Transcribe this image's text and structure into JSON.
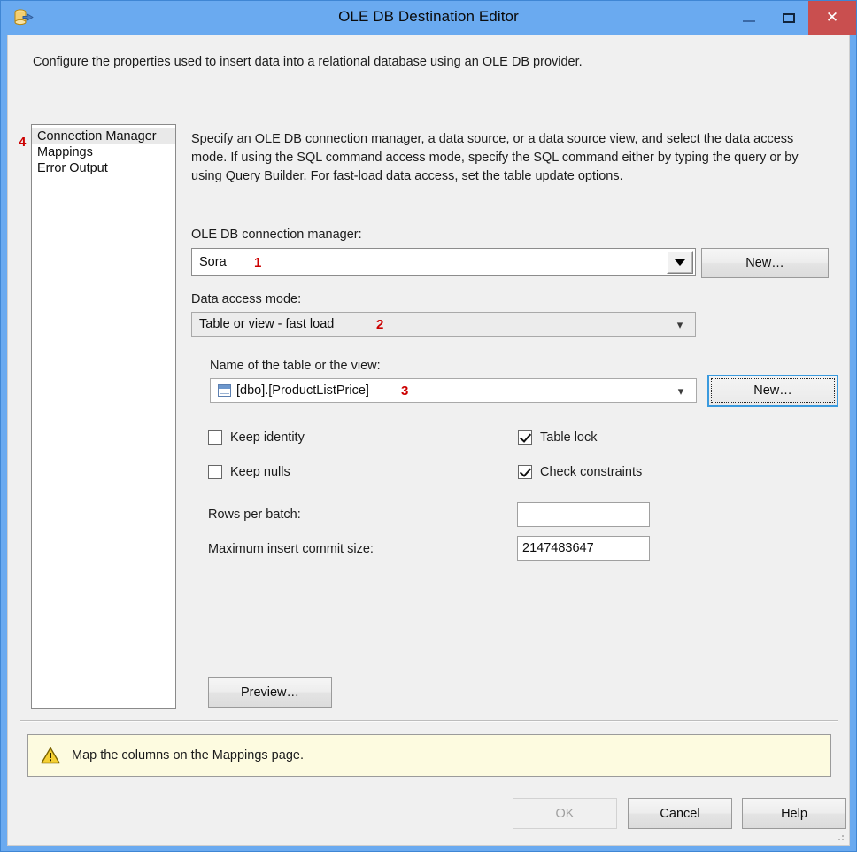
{
  "window": {
    "title": "OLE DB Destination Editor",
    "icon": "database-destination-icon",
    "minimize_label": "",
    "maximize_label": "",
    "close_label": "✕"
  },
  "intro": "Configure the properties used to insert data into a relational database using an OLE DB provider.",
  "nav": {
    "annotation": "4",
    "items": [
      {
        "label": "Connection Manager",
        "selected": true
      },
      {
        "label": "Mappings",
        "selected": false
      },
      {
        "label": "Error Output",
        "selected": false
      }
    ]
  },
  "description": "Specify an OLE DB connection manager, a data source, or a data source view, and select the data access mode. If using the SQL command access mode, specify the SQL command either by typing the query or by using Query Builder. For fast-load data access, set the table update options.",
  "connection_manager": {
    "label": "OLE DB connection manager:",
    "value": "Sora",
    "annotation": "1",
    "new_button": "New…"
  },
  "data_access_mode": {
    "label": "Data access mode:",
    "value": "Table or view - fast load",
    "annotation": "2"
  },
  "table_or_view": {
    "label": "Name of the table or the view:",
    "value": "[dbo].[ProductListPrice]",
    "annotation": "3",
    "icon": "table-icon",
    "new_button": "New…"
  },
  "options": {
    "keep_identity": {
      "label": "Keep identity",
      "checked": false
    },
    "keep_nulls": {
      "label": "Keep nulls",
      "checked": false
    },
    "table_lock": {
      "label": "Table lock",
      "checked": true
    },
    "check_constraints": {
      "label": "Check constraints",
      "checked": true
    }
  },
  "rows_per_batch": {
    "label": "Rows per batch:",
    "value": ""
  },
  "max_insert_commit_size": {
    "label": "Maximum insert commit size:",
    "value": "2147483647"
  },
  "preview_button": "Preview…",
  "warning": {
    "icon": "warning-triangle-icon",
    "text": "Map the columns on the Mappings page."
  },
  "footer": {
    "ok": "OK",
    "ok_disabled": true,
    "cancel": "Cancel",
    "help": "Help"
  },
  "colors": {
    "titlebar": "#6aaaf0",
    "close_button": "#c94f4f",
    "client_background": "#f0f0f0",
    "warning_background": "#fdfbe0",
    "annotation": "#cc0000",
    "focus_border": "#3a9ade"
  }
}
